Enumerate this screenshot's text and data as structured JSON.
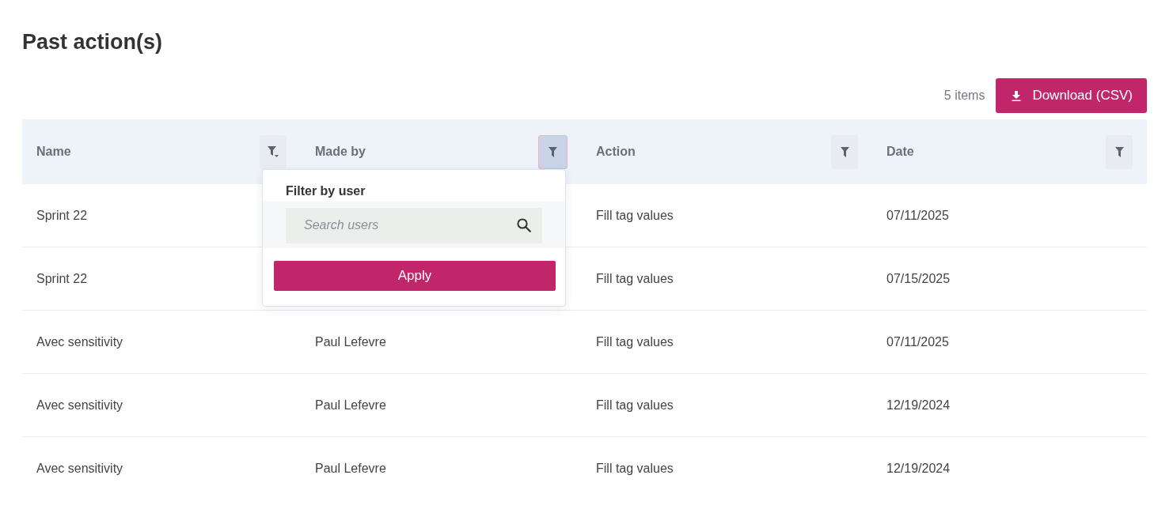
{
  "page": {
    "title": "Past action(s)"
  },
  "toolbar": {
    "count": "5 items",
    "download_button": "Download (CSV)"
  },
  "table": {
    "columns": [
      {
        "label": "Name",
        "kind": "caret-filter",
        "filter_open": false
      },
      {
        "label": "Made by",
        "kind": "filter",
        "filter_open": true
      },
      {
        "label": "Action",
        "kind": "filter",
        "filter_open": false
      },
      {
        "label": "Date",
        "kind": "filter",
        "filter_open": false
      }
    ],
    "rows": [
      {
        "name": "Sprint 22",
        "action": "Fill tag values",
        "date": "07/11/2025"
      },
      {
        "name": "Sprint 22",
        "action": "Fill tag values",
        "date": "07/15/2025"
      },
      {
        "name": "Avec sensitivity",
        "made_by": "Paul Lefevre",
        "action": "Fill tag values",
        "date": "07/11/2025"
      },
      {
        "name": "Avec sensitivity",
        "made_by": "Paul Lefevre",
        "action": "Fill tag values",
        "date": "12/19/2024"
      },
      {
        "name": "Avec sensitivity",
        "made_by": "Paul Lefevre",
        "action": "Fill tag values",
        "date": "12/19/2024"
      }
    ]
  },
  "filter_popover": {
    "title": "Filter by user",
    "search": {
      "placeholder": "Search users"
    },
    "apply_button": "Apply"
  }
}
